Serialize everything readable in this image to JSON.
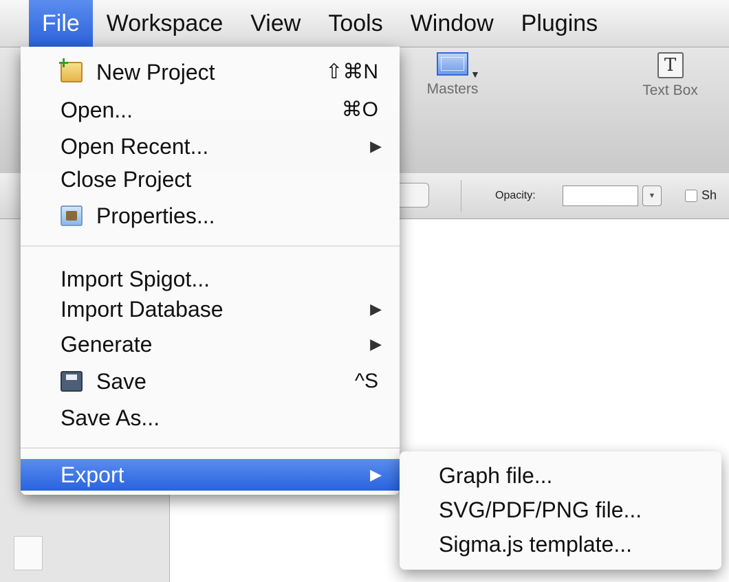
{
  "menubar": {
    "items": [
      {
        "label": "File"
      },
      {
        "label": "Workspace"
      },
      {
        "label": "View"
      },
      {
        "label": "Tools"
      },
      {
        "label": "Window"
      },
      {
        "label": "Plugins"
      }
    ]
  },
  "toolbar": {
    "masters_label": "Masters",
    "textbox_label": "Text Box",
    "textbox_glyph": "T",
    "dropdown_glyph": "▼"
  },
  "formatbar": {
    "opacity_label": "Opacity:",
    "opacity_value": "",
    "stepper_glyph": "▼",
    "show_label": "Sh"
  },
  "file_menu": {
    "items": [
      {
        "label": "New Project",
        "shortcut": "⇧⌘N",
        "icon": "new-project-icon"
      },
      {
        "label": "Open...",
        "shortcut": "⌘O"
      },
      {
        "label": "Open Recent...",
        "submenu": "▶"
      },
      {
        "label": "Close Project"
      },
      {
        "label": "Properties...",
        "icon": "properties-icon"
      },
      {
        "label": "Import Spigot..."
      },
      {
        "label": "Import Database",
        "submenu": "▶"
      },
      {
        "label": "Generate",
        "submenu": "▶"
      },
      {
        "label": "Save",
        "shortcut": "^S",
        "icon": "save-icon"
      },
      {
        "label": "Save As..."
      },
      {
        "label": "Export",
        "submenu": "▶",
        "highlighted": true
      }
    ]
  },
  "export_submenu": {
    "items": [
      {
        "label": "Graph file..."
      },
      {
        "label": "SVG/PDF/PNG file..."
      },
      {
        "label": "Sigma.js template..."
      }
    ]
  },
  "colors": {
    "highlight": "#2b62d9",
    "menu_background": "#fafafa"
  }
}
